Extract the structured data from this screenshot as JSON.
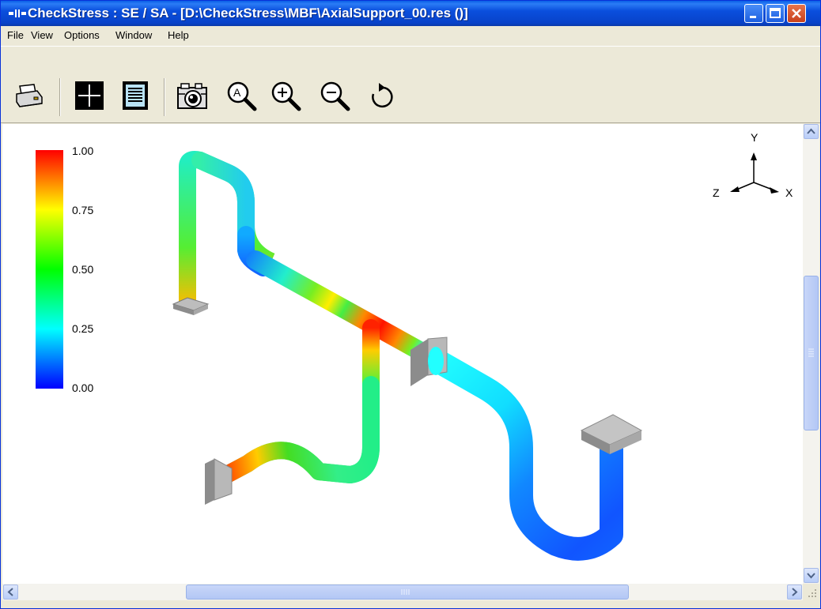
{
  "window": {
    "title": "CheckStress : SE / SA -  [D:\\CheckStress\\MBF\\AxialSupport_00.res ()]"
  },
  "menu": {
    "items": [
      {
        "label": "File"
      },
      {
        "label": "View"
      },
      {
        "label": "Options"
      },
      {
        "label": "Window"
      },
      {
        "label": "Help"
      }
    ]
  },
  "toolbar": {
    "icons": [
      "printer-icon",
      "crosshair-icon",
      "report-icon",
      "camera-icon",
      "zoom-fit-icon",
      "zoom-in-icon",
      "zoom-out-icon",
      "rotate-icon"
    ]
  },
  "legend": {
    "ticks": [
      "1.00",
      "0.75",
      "0.50",
      "0.25",
      "0.00"
    ],
    "colors": [
      "#ff0000",
      "#ffff00",
      "#00ff00",
      "#00ffff",
      "#0000ff"
    ]
  },
  "axes": {
    "y": "Y",
    "z": "Z",
    "x": "X"
  },
  "colors": {
    "titlebar": "#0a4fdd",
    "window_bg": "#ece9d8"
  }
}
